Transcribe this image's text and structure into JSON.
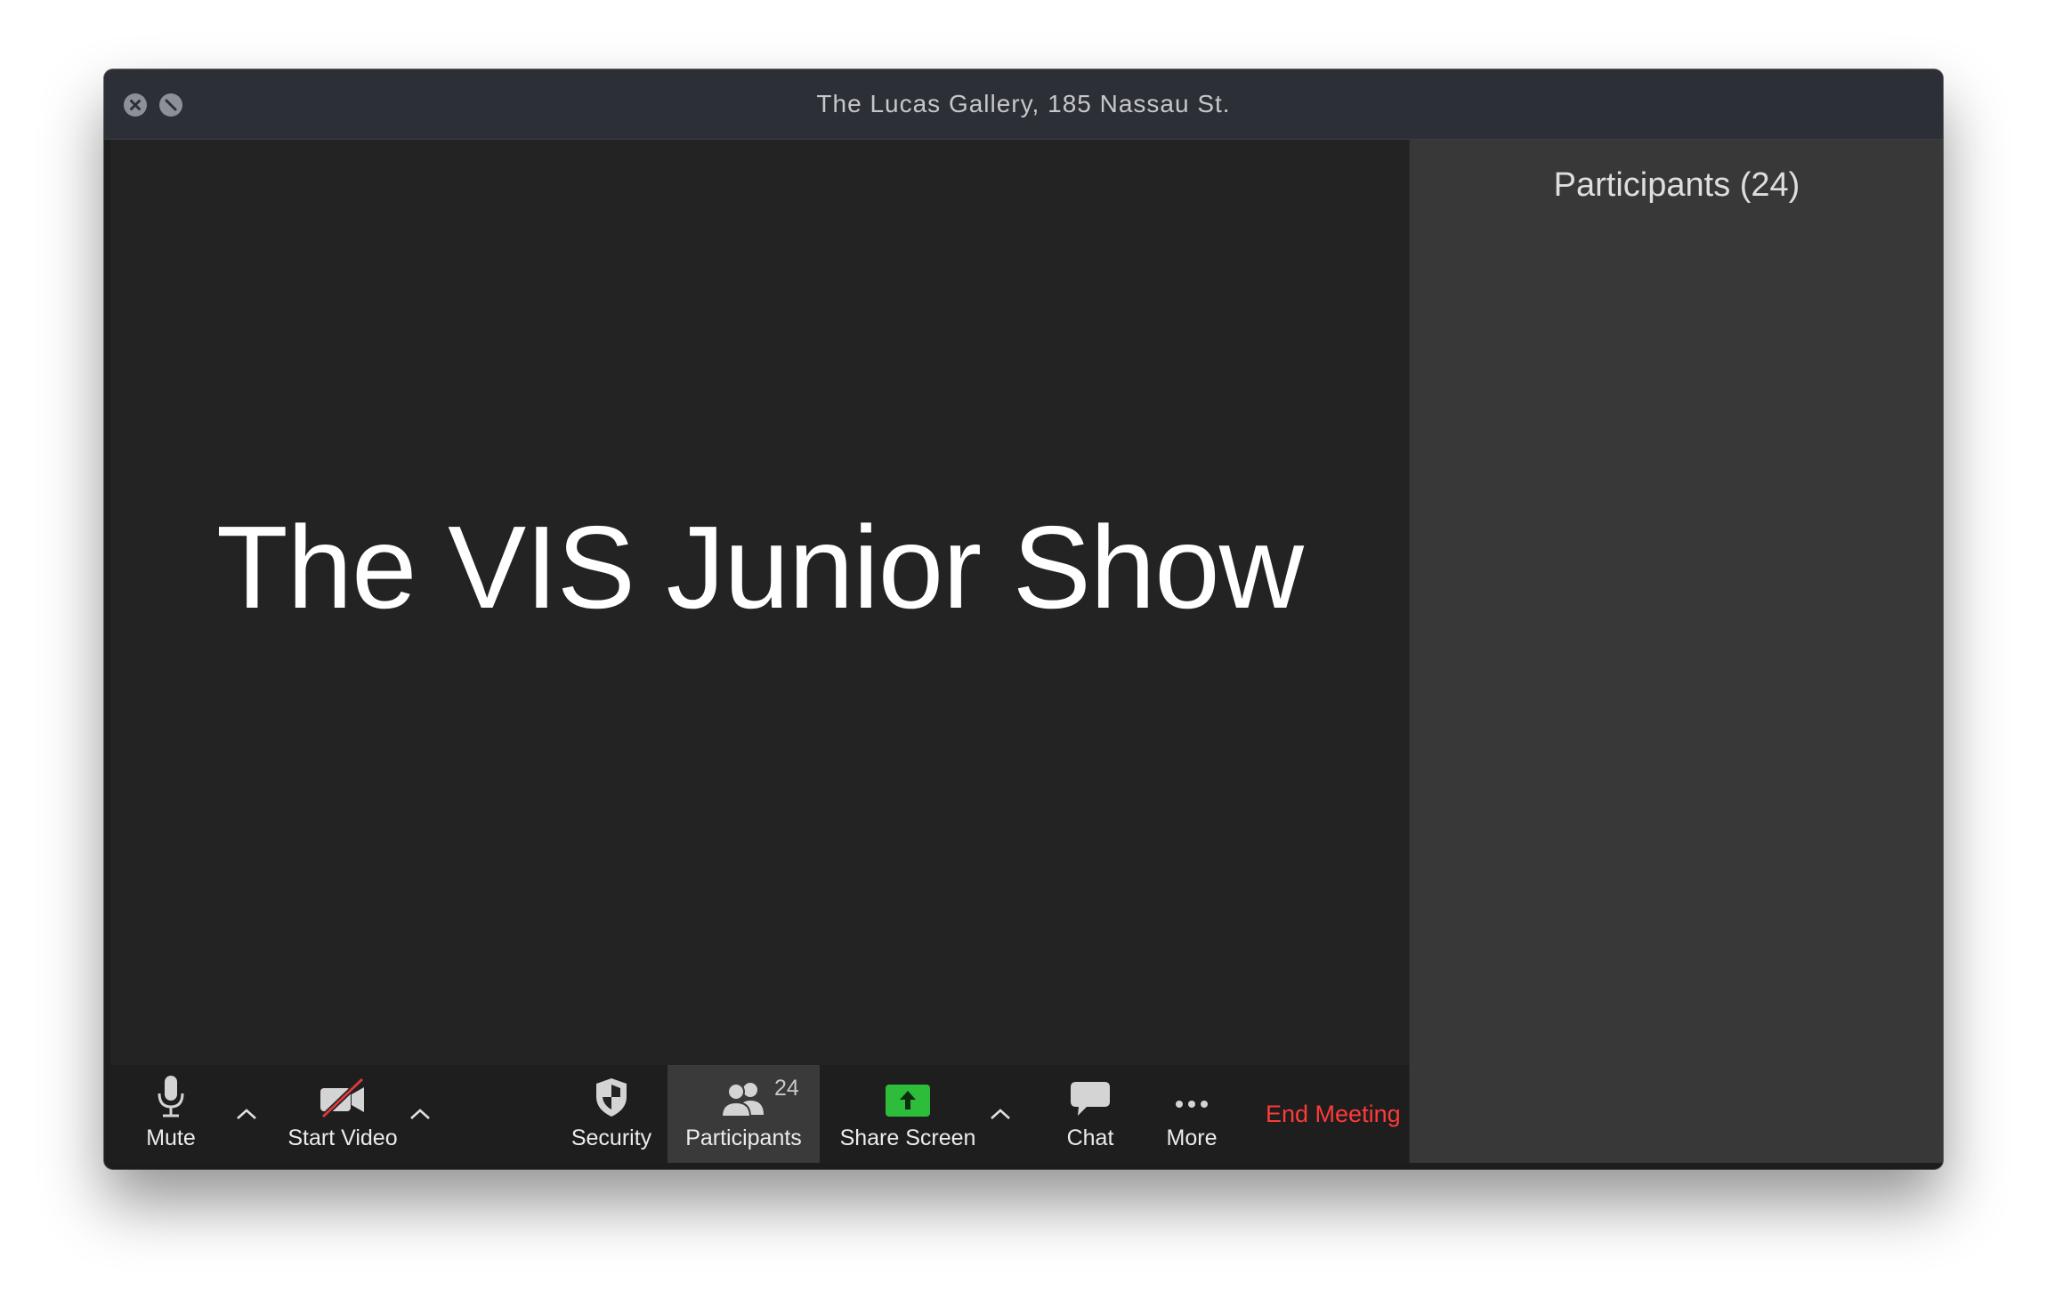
{
  "window": {
    "title": "The Lucas Gallery, 185 Nassau St.",
    "controls": [
      "close-icon",
      "minimize-icon"
    ]
  },
  "share": {
    "content_title": "The VIS Junior Show"
  },
  "toolbar": {
    "mute_label": "Mute",
    "start_video_label": "Start Video",
    "security_label": "Security",
    "participants_label": "Participants",
    "participants_count": "24",
    "share_screen_label": "Share Screen",
    "chat_label": "Chat",
    "more_label": "More",
    "end_meeting_label": "End Meeting",
    "accent_green": "#2dbd3a",
    "end_color": "#ff3a3a"
  },
  "participants_panel": {
    "title": "Participants (24)"
  }
}
